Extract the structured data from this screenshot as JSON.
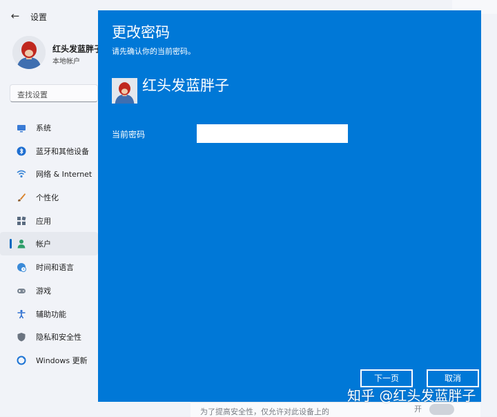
{
  "window": {
    "title": "设置"
  },
  "profile": {
    "name": "红头发蓝胖子",
    "account_type": "本地帐户"
  },
  "search": {
    "placeholder": "查找设置"
  },
  "nav": {
    "items": [
      {
        "label": "系统",
        "icon": "monitor-icon",
        "color": "#3a7bd5"
      },
      {
        "label": "蓝牙和其他设备",
        "icon": "bluetooth-icon",
        "color": "#1f6fd1"
      },
      {
        "label": "网络 & Internet",
        "icon": "wifi-icon",
        "color": "#3b86d6"
      },
      {
        "label": "个性化",
        "icon": "brush-icon",
        "color": "#d9822b"
      },
      {
        "label": "应用",
        "icon": "apps-icon",
        "color": "#5a6b80"
      },
      {
        "label": "帐户",
        "icon": "person-icon",
        "color": "#2e9e6a",
        "active": true
      },
      {
        "label": "时间和语言",
        "icon": "globe-clock-icon",
        "color": "#3a8ad8"
      },
      {
        "label": "游戏",
        "icon": "gamepad-icon",
        "color": "#7c8794"
      },
      {
        "label": "辅助功能",
        "icon": "accessibility-icon",
        "color": "#2d6fd0"
      },
      {
        "label": "隐私和安全性",
        "icon": "shield-icon",
        "color": "#6b7480"
      },
      {
        "label": "Windows 更新",
        "icon": "update-icon",
        "color": "#1d74d4"
      }
    ]
  },
  "background": {
    "bottom_text": "为了提高安全性，仅允许对此设备上的",
    "toggle_label": "开"
  },
  "dialog": {
    "title": "更改密码",
    "subtitle": "请先确认你的当前密码。",
    "user_name": "红头发蓝胖子",
    "password_label": "当前密码",
    "password_value": "",
    "next_label": "下一页",
    "cancel_label": "取消",
    "accent": "#0078d7"
  },
  "watermark": "知乎 @红头发蓝胖子"
}
